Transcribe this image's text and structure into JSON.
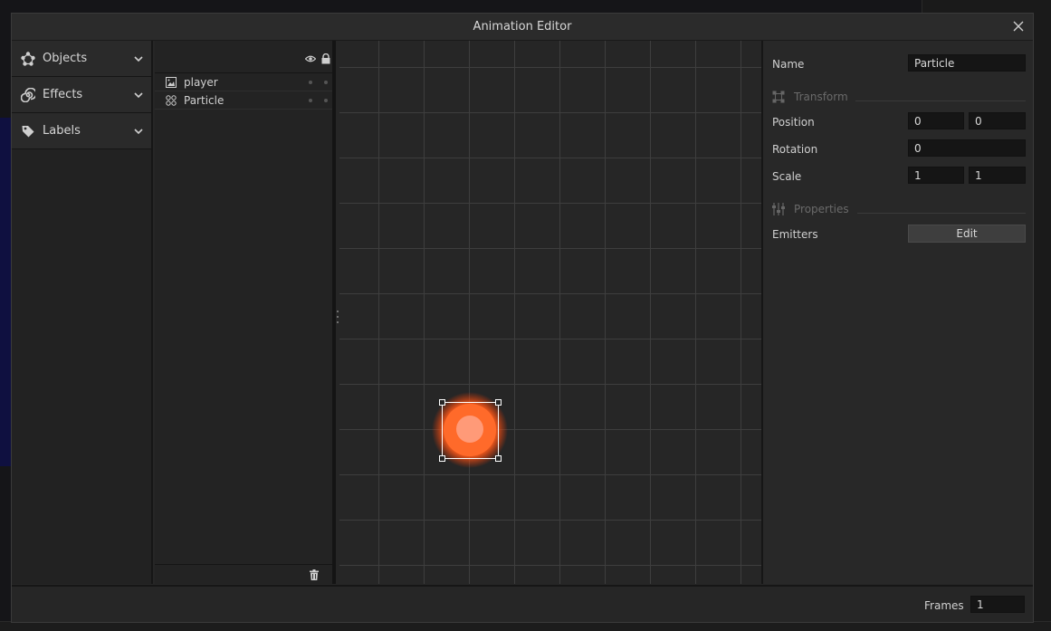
{
  "window": {
    "title": "Animation Editor",
    "close_icon": "close-icon"
  },
  "categories": [
    {
      "label": "Objects",
      "icon": "objects-icon"
    },
    {
      "label": "Effects",
      "icon": "spiral-icon"
    },
    {
      "label": "Labels",
      "icon": "tag-icon"
    }
  ],
  "layers": {
    "header_icons": [
      "eye-icon",
      "lock-icon"
    ],
    "items": [
      {
        "name": "player",
        "icon": "image-icon"
      },
      {
        "name": "Particle",
        "icon": "particle-icon"
      }
    ],
    "footer_icon": "trash-icon"
  },
  "inspector": {
    "name_label": "Name",
    "name_value": "Particle",
    "transform_section": "Transform",
    "position_label": "Position",
    "position_x": "0",
    "position_y": "0",
    "rotation_label": "Rotation",
    "rotation_value": "0",
    "scale_label": "Scale",
    "scale_x": "1",
    "scale_y": "1",
    "properties_section": "Properties",
    "emitters_label": "Emitters",
    "edit_button": "Edit"
  },
  "footer": {
    "frames_label": "Frames",
    "frames_value": "1"
  },
  "colors": {
    "particle_core": "#ff6a2a",
    "particle_highlight": "#ff9a78",
    "background": "#262626"
  }
}
